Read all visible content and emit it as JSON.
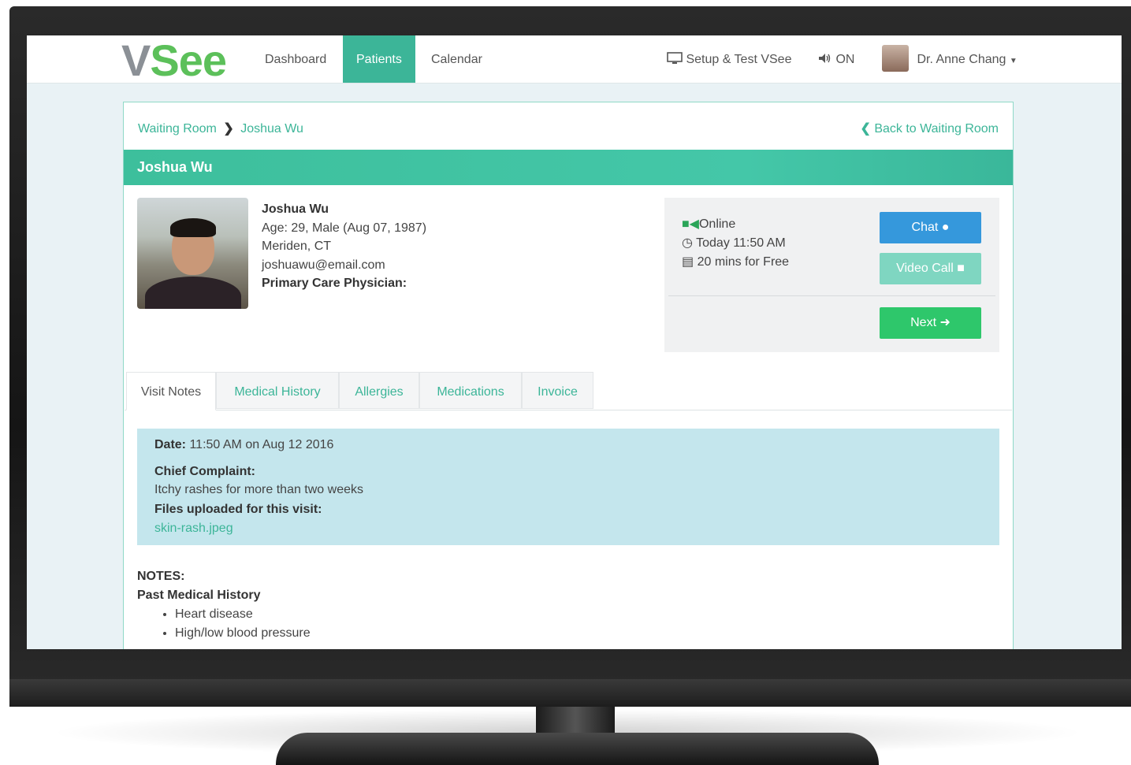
{
  "brand": {
    "logo_v": "V",
    "logo_see": "See"
  },
  "nav": {
    "items": [
      {
        "label": "Dashboard"
      },
      {
        "label": "Patients"
      },
      {
        "label": "Calendar"
      }
    ],
    "setup_label": "Setup & Test VSee",
    "sound_label": "ON",
    "user_name": "Dr. Anne Chang"
  },
  "breadcrumb": {
    "parent": "Waiting Room",
    "current": "Joshua Wu"
  },
  "back_link": "Back to Waiting Room",
  "title_bar": "Joshua Wu",
  "patient": {
    "name": "Joshua Wu",
    "age_line": "Age: 29, Male (Aug 07, 1987)",
    "location": "Meriden, CT",
    "email": "joshuawu@email.com",
    "pcp_label": "Primary Care Physician:"
  },
  "status": {
    "online": "Online",
    "time": "Today 11:50 AM",
    "billing": "20 mins for Free"
  },
  "actions": {
    "chat": "Chat",
    "video": "Video Call",
    "next": "Next"
  },
  "tabs": [
    {
      "label": "Visit Notes"
    },
    {
      "label": "Medical History"
    },
    {
      "label": "Allergies"
    },
    {
      "label": "Medications"
    },
    {
      "label": "Invoice"
    }
  ],
  "visit": {
    "date_label": "Date:",
    "date_value": "11:50 AM on Aug 12 2016",
    "complaint_label": "Chief Complaint:",
    "complaint_value": "Itchy rashes for more than two weeks",
    "files_label": "Files uploaded for this visit:",
    "file_name": "skin-rash.jpeg"
  },
  "notes": {
    "heading": "NOTES:",
    "section": "Past Medical History",
    "items": [
      "Heart disease",
      "High/low blood pressure"
    ]
  },
  "colors": {
    "accent": "#3cb598",
    "chat_button": "#3598dc",
    "video_button": "#7fd6c1",
    "next_button": "#2ec76b",
    "visit_box": "#c4e6ed"
  }
}
